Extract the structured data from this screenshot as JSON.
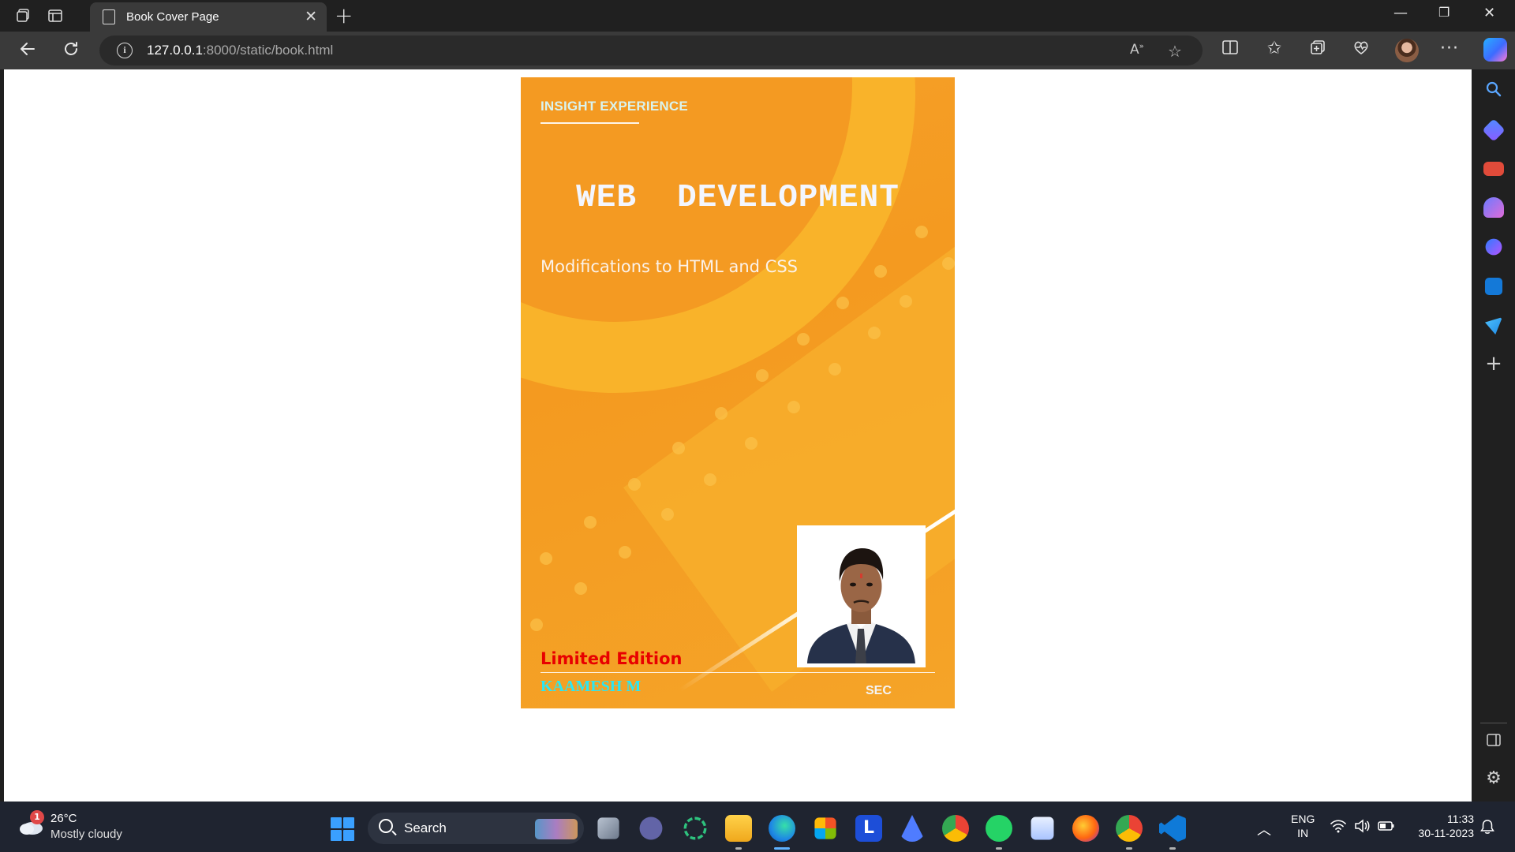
{
  "browser": {
    "tab_title": "Book Cover Page",
    "url_host": "127.0.0.1",
    "url_path": ":8000/static/book.html"
  },
  "book": {
    "brand": "INSIGHT EXPERIENCE",
    "title": "WEB  DEVELOPMENT",
    "subtitle": "Modifications to HTML and CSS",
    "edition": "Limited Edition",
    "author": "KAAMESH M",
    "publisher": "SEC",
    "colors": {
      "background": "#f49a20",
      "edition_text": "#e80000",
      "author_text": "#2ce6f2"
    }
  },
  "taskbar": {
    "weather_badge": "1",
    "weather_temp": "26°C",
    "weather_desc": "Mostly cloudy",
    "search_label": "Search",
    "lang_line1": "ENG",
    "lang_line2": "IN",
    "time": "11:33",
    "date": "30-11-2023"
  },
  "icons": {
    "titlebar": [
      "workspaces-icon",
      "tab-actions-icon"
    ],
    "toolbar": [
      "read-aloud-icon",
      "favorite-star-icon",
      "split-screen-icon",
      "favorites-icon",
      "collections-icon",
      "browser-essentials-icon",
      "profile-avatar",
      "more-options-icon",
      "copilot-icon"
    ],
    "sidebar": [
      "search-icon",
      "shopping-icon",
      "tools-icon",
      "games-icon",
      "microsoft-365-icon",
      "outlook-icon",
      "drop-icon",
      "add-icon",
      "hide-sidebar-icon",
      "settings-icon"
    ],
    "taskbar_apps": [
      "start-icon",
      "task-view-icon",
      "teams-chat-icon",
      "refresh-app-icon",
      "file-explorer-icon",
      "edge-icon",
      "store-icon",
      "l-app-icon",
      "arc-icon",
      "chrome-icon",
      "whatsapp-icon",
      "notepad-icon",
      "firefox-icon",
      "chrome-profile-icon",
      "vscode-icon"
    ]
  }
}
